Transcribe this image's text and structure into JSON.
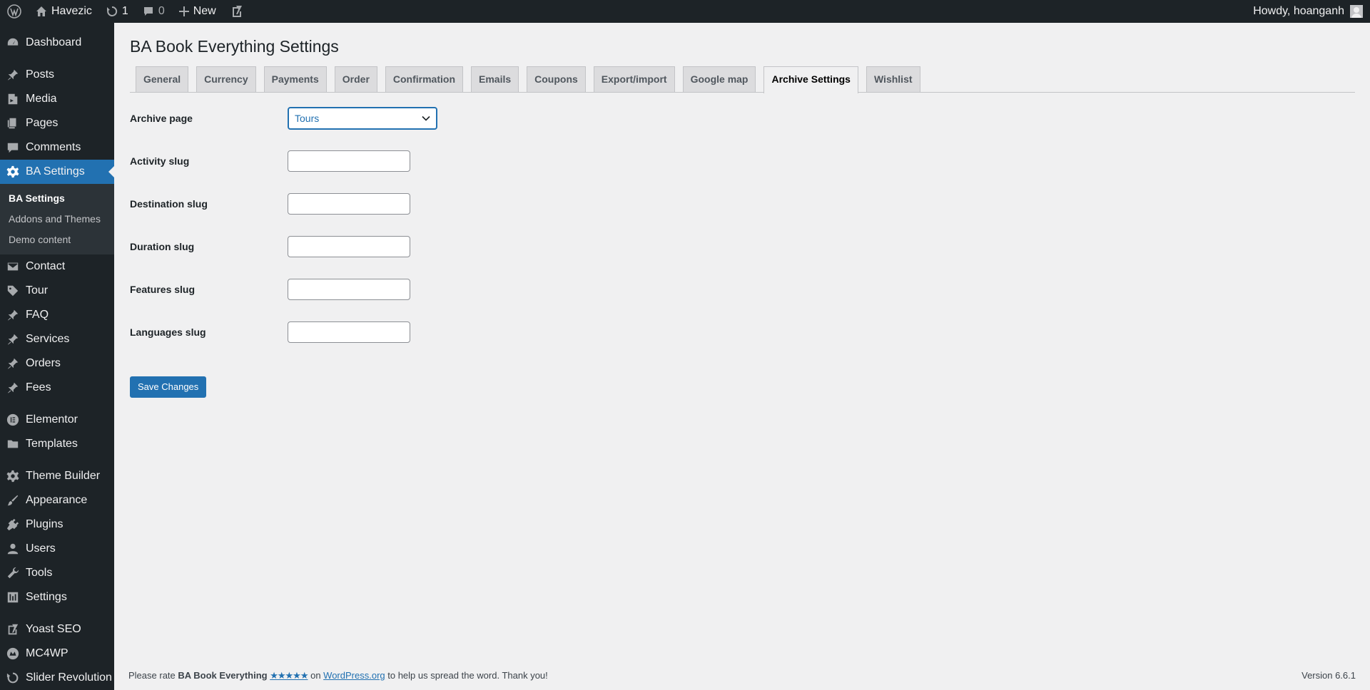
{
  "admin_bar": {
    "site_name": "Havezic",
    "updates_count": "1",
    "comments_count": "0",
    "new_label": "New",
    "greeting": "Howdy, hoanganh"
  },
  "sidebar": {
    "items": [
      {
        "label": "Dashboard",
        "icon": "dashboard-icon"
      },
      {
        "label": "Posts",
        "icon": "pin-icon"
      },
      {
        "label": "Media",
        "icon": "media-icon"
      },
      {
        "label": "Pages",
        "icon": "pages-icon"
      },
      {
        "label": "Comments",
        "icon": "comment-icon"
      },
      {
        "label": "BA Settings",
        "icon": "gear-icon"
      },
      {
        "label": "Contact",
        "icon": "mail-icon"
      },
      {
        "label": "Tour",
        "icon": "tag-icon"
      },
      {
        "label": "FAQ",
        "icon": "pin-icon"
      },
      {
        "label": "Services",
        "icon": "pin-icon"
      },
      {
        "label": "Orders",
        "icon": "pin-icon"
      },
      {
        "label": "Fees",
        "icon": "pin-icon"
      },
      {
        "label": "Elementor",
        "icon": "elementor-icon"
      },
      {
        "label": "Templates",
        "icon": "folder-icon"
      },
      {
        "label": "Theme Builder",
        "icon": "gear-icon"
      },
      {
        "label": "Appearance",
        "icon": "brush-icon"
      },
      {
        "label": "Plugins",
        "icon": "plug-icon"
      },
      {
        "label": "Users",
        "icon": "user-icon"
      },
      {
        "label": "Tools",
        "icon": "wrench-icon"
      },
      {
        "label": "Settings",
        "icon": "settings-icon"
      },
      {
        "label": "Yoast SEO",
        "icon": "yoast-icon"
      },
      {
        "label": "MC4WP",
        "icon": "mc4wp-icon"
      },
      {
        "label": "Slider Revolution",
        "icon": "refresh-icon"
      }
    ],
    "submenu": [
      {
        "label": "BA Settings"
      },
      {
        "label": "Addons and Themes"
      },
      {
        "label": "Demo content"
      }
    ]
  },
  "page": {
    "title": "BA Book Everything Settings",
    "tabs": [
      {
        "label": "General"
      },
      {
        "label": "Currency"
      },
      {
        "label": "Payments"
      },
      {
        "label": "Order"
      },
      {
        "label": "Confirmation"
      },
      {
        "label": "Emails"
      },
      {
        "label": "Coupons"
      },
      {
        "label": "Export/import"
      },
      {
        "label": "Google map"
      },
      {
        "label": "Archive Settings"
      },
      {
        "label": "Wishlist"
      }
    ],
    "active_tab": "Archive Settings"
  },
  "form": {
    "archive_page_label": "Archive page",
    "archive_page_value": "Tours",
    "fields": [
      {
        "label": "Activity slug",
        "value": ""
      },
      {
        "label": "Destination slug",
        "value": ""
      },
      {
        "label": "Duration slug",
        "value": ""
      },
      {
        "label": "Features slug",
        "value": ""
      },
      {
        "label": "Languages slug",
        "value": ""
      }
    ],
    "save_label": "Save Changes"
  },
  "footer": {
    "text_before": "Please rate ",
    "plugin_name": "BA Book Everything",
    "stars": "★★★★★",
    "text_on": " on ",
    "link": "WordPress.org",
    "text_after": " to help us spread the word. Thank you!",
    "version": "Version 6.6.1"
  },
  "colors": {
    "accent": "#2271b1",
    "admin_bg": "#1d2327",
    "content_bg": "#f0f0f1"
  }
}
